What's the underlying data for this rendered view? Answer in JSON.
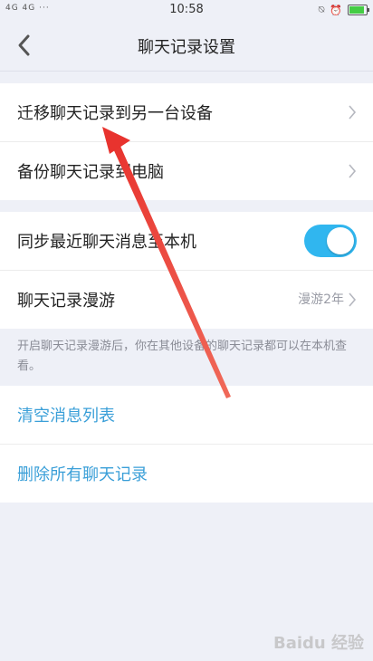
{
  "status_bar": {
    "signal": "4G 4G",
    "time": "10:58",
    "dots": "···"
  },
  "header": {
    "title": "聊天记录设置",
    "back_icon": "chevron-left-icon"
  },
  "group1": {
    "items": [
      {
        "label": "迁移聊天记录到另一台设备"
      },
      {
        "label": "备份聊天记录到电脑"
      }
    ]
  },
  "group2": {
    "sync": {
      "label": "同步最近聊天消息至本机",
      "enabled": true
    },
    "roaming": {
      "label": "聊天记录漫游",
      "value": "漫游2年"
    }
  },
  "note": "开启聊天记录漫游后，你在其他设备的聊天记录都可以在本机查看。",
  "group3": {
    "clear": {
      "label": "清空消息列表"
    },
    "delete": {
      "label": "删除所有聊天记录"
    }
  },
  "watermark": "Baidu 经验",
  "colors": {
    "accent": "#3a9fd8",
    "toggle": "#30b6ef",
    "annotation_arrow": "#e8332e"
  }
}
